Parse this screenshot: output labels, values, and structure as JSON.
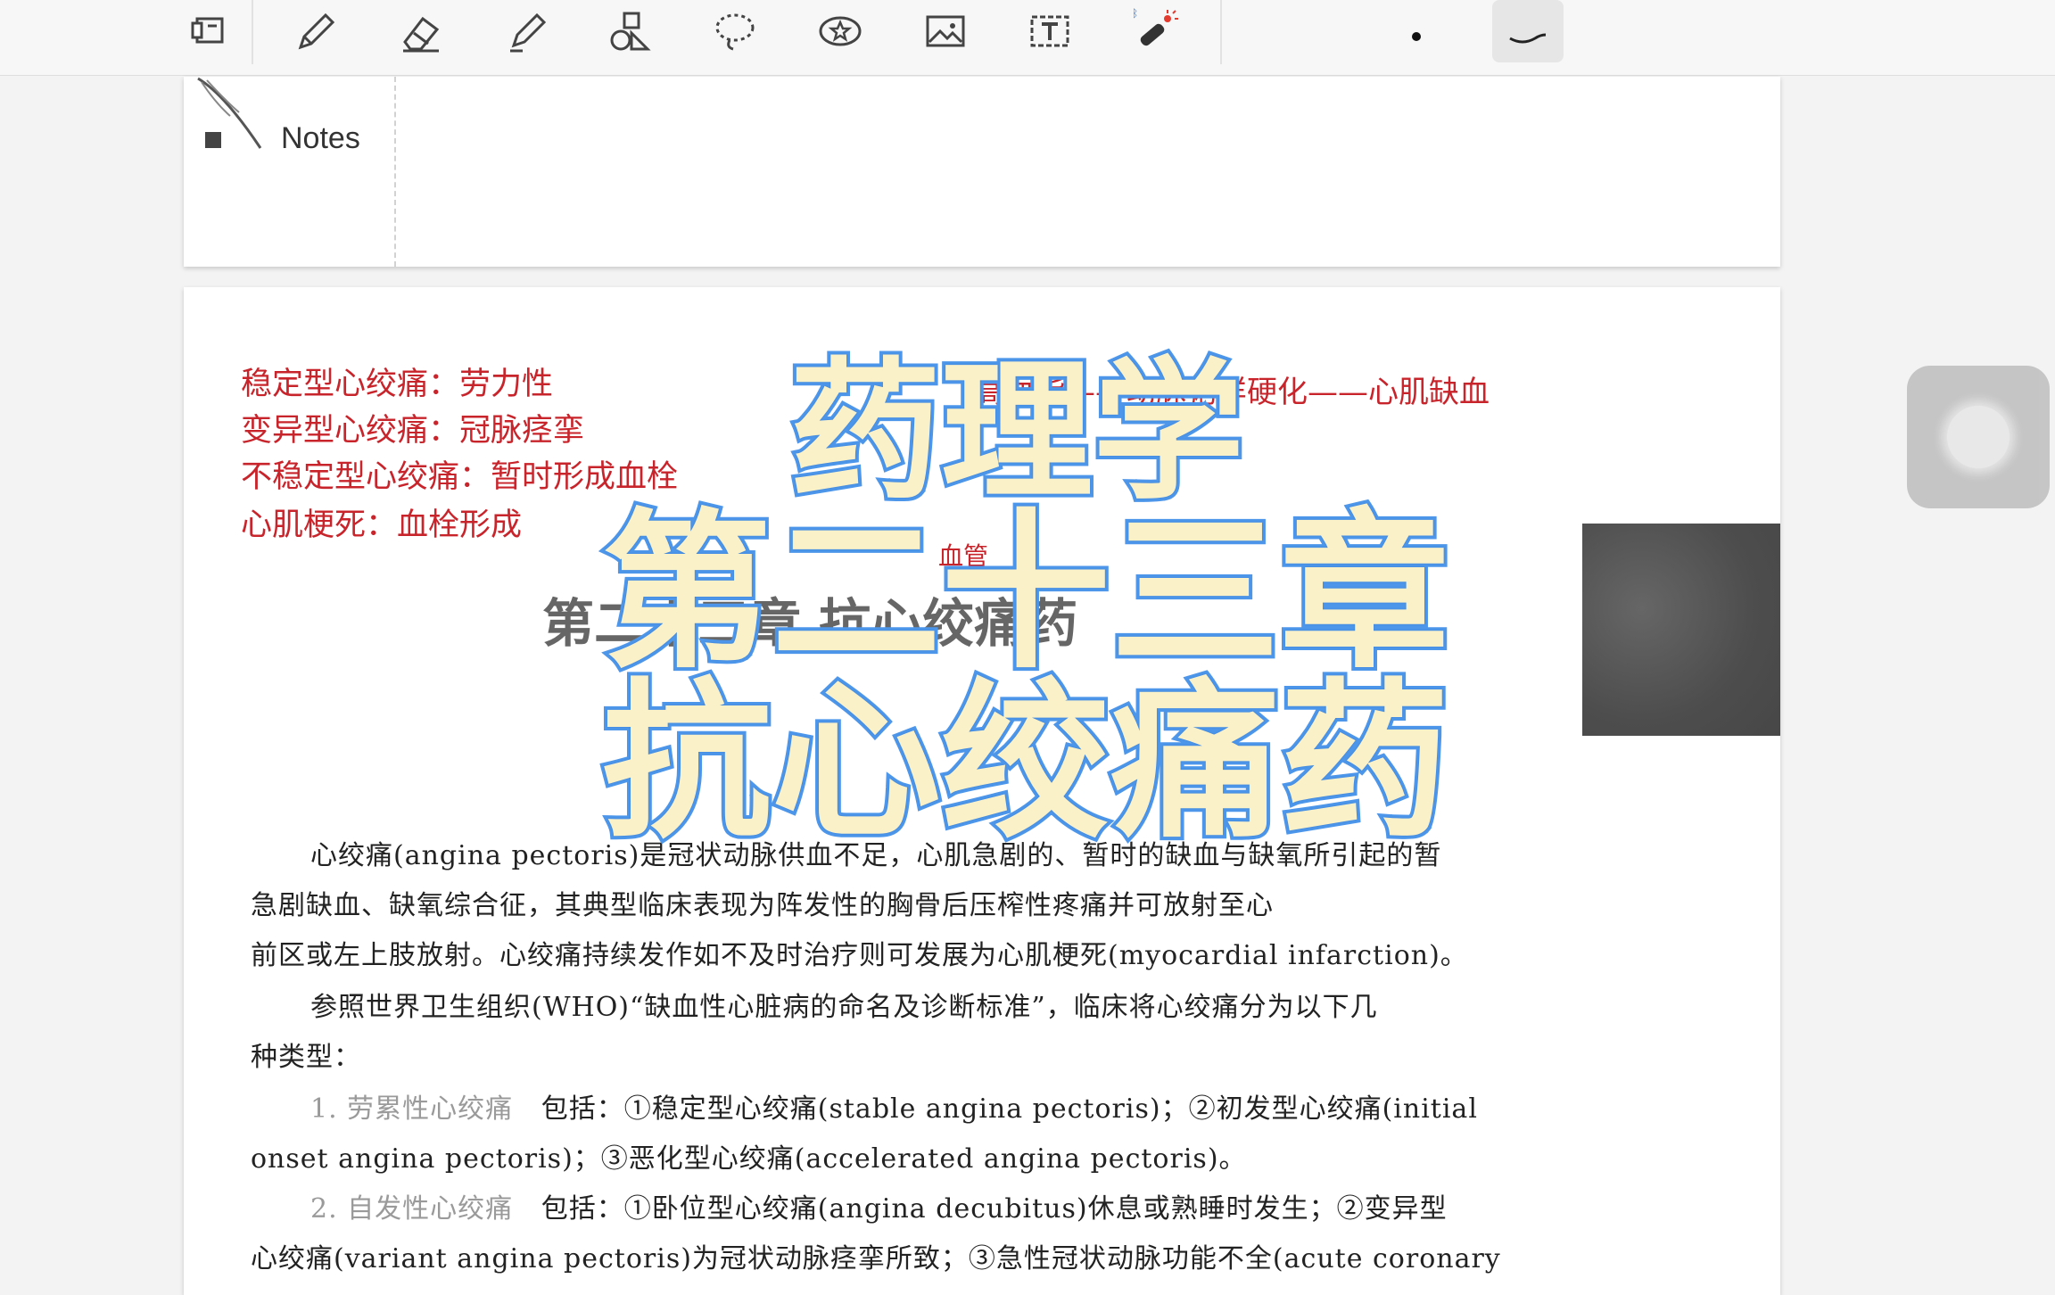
{
  "toolbar": {
    "tools": [
      {
        "name": "page-layout-icon"
      },
      {
        "name": "pen-icon"
      },
      {
        "name": "eraser-icon"
      },
      {
        "name": "highlighter-icon"
      },
      {
        "name": "shapes-icon"
      },
      {
        "name": "lasso-icon"
      },
      {
        "name": "sticker-icon"
      },
      {
        "name": "image-icon"
      },
      {
        "name": "text-box-icon"
      },
      {
        "name": "laser-pointer-icon"
      }
    ],
    "dot_tool": "small-dot-icon",
    "stroke_tool": "curve-stroke-icon"
  },
  "notes_page": {
    "label": "Notes"
  },
  "red_notes": {
    "left": [
      "稳定型心绞痛：劳力性",
      "变异型心绞痛：冠脉痉挛",
      "不稳定型心绞痛：暂时形成血栓",
      "心肌梗死：血栓形成"
    ],
    "right": "高血脂——动脉粥样硬化——心肌缺血",
    "small": "血管"
  },
  "chapter_heading_faded": "第二十三章 抗心绞痛药",
  "body_lines": [
    "心绞痛(angina pectoris)是冠状动脉供血不足，心肌急剧的、暂时的缺血与缺氧所引起的暂",
    "急剧缺血、缺氧综合征，其典型临床表现为阵发性的胸骨后压榨性疼痛并可放射至心",
    "前区或左上肢放射。心绞痛持续发作如不及时治疗则可发展为心肌梗死(myocardial infarction)。",
    "参照世界卫生组织(WHO)“缺血性心脏病的命名及诊断标准”，临床将心绞痛分为以下几",
    "种类型：",
    "onset angina pectoris)；③恶化型心绞痛(accelerated angina pectoris)。",
    "心绞痛(variant angina pectoris)为冠状动脉痉挛所致；③急性冠状动脉功能不全(acute coronary"
  ],
  "list_items": [
    {
      "num": "1.",
      "label": "劳累性心绞痛",
      "text": "包括：①稳定型心绞痛(stable angina pectoris)；②初发型心绞痛(initial"
    },
    {
      "num": "2.",
      "label": "自发性心绞痛",
      "text": "包括：①卧位型心绞痛(angina decubitus)休息或熟睡时发生；②变异型"
    }
  ],
  "overlay_title": {
    "line1": "药理学",
    "line2": "第二十三章",
    "line3": "抗心绞痛药"
  },
  "colors": {
    "annotation_red": "#c8242b",
    "title_fill": "#fbf1c9",
    "title_stroke": "#4d96ea"
  }
}
